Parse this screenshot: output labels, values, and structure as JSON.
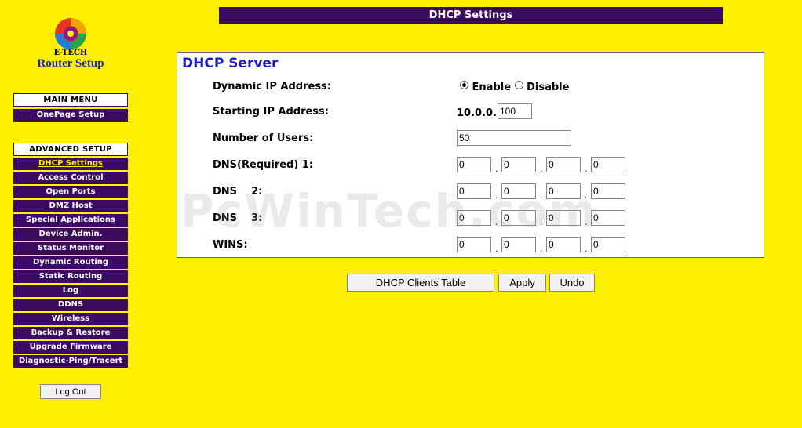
{
  "logo": {
    "brand": "E-TECH",
    "subtitle": "Router Setup"
  },
  "nav": {
    "main_header": "MAIN MENU",
    "main_items": [
      "OnePage Setup"
    ],
    "advanced_header": "ADVANCED SETUP",
    "advanced_items": [
      "DHCP Settings",
      "Access Control",
      "Open Ports",
      "DMZ Host",
      "Special Applications",
      "Device Admin.",
      "Status Monitor",
      "Dynamic Routing",
      "Static Routing",
      "Log",
      "DDNS",
      "Wireless",
      "Backup & Restore",
      "Upgrade Firmware",
      "Diagnostic-Ping/Tracert"
    ],
    "active": "DHCP Settings",
    "logout_label": "Log Out"
  },
  "page_title": "DHCP Settings",
  "dhcp": {
    "section_title": "DHCP Server",
    "dynamic_ip_label": "Dynamic IP Address:",
    "enable_label": "Enable",
    "disable_label": "Disable",
    "selected": "Enable",
    "starting_ip_label": "Starting IP Address:",
    "starting_ip_prefix": "10.0.0.",
    "starting_ip_value": "100",
    "num_users_label": "Number of Users:",
    "num_users_value": "50",
    "dns1_label": "DNS(Required)   1:",
    "dns1": [
      "0",
      "0",
      "0",
      "0"
    ],
    "dns2_label": "DNS    2:",
    "dns2": [
      "0",
      "0",
      "0",
      "0"
    ],
    "dns3_label": "DNS    3:",
    "dns3": [
      "0",
      "0",
      "0",
      "0"
    ],
    "wins_label": "WINS:",
    "wins": [
      "0",
      "0",
      "0",
      "0"
    ]
  },
  "buttons": {
    "clients_table": "DHCP Clients Table",
    "apply": "Apply",
    "undo": "Undo"
  },
  "watermark": "PcWinTech.com",
  "colors": {
    "background": "#FFEF00",
    "nav": "#3b0a63",
    "title_blue": "#1d1dbe"
  }
}
